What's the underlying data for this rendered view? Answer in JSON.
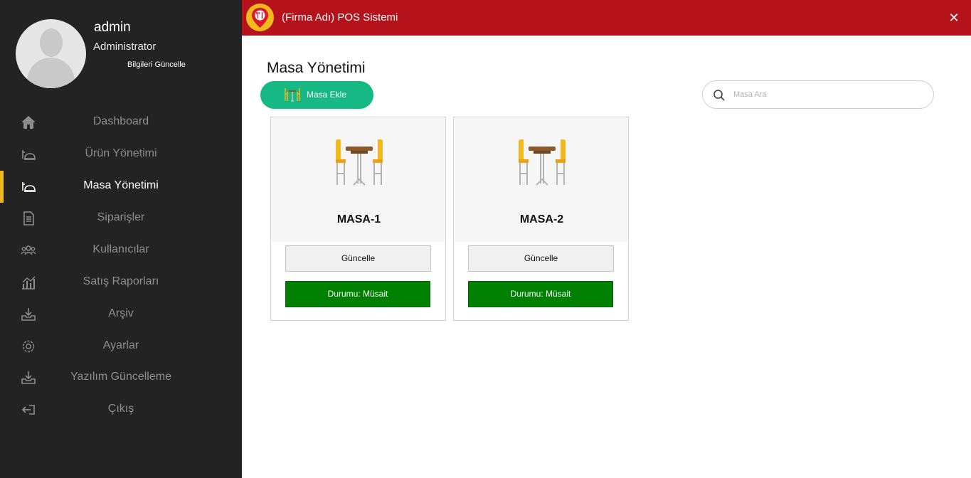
{
  "user": {
    "name": "admin",
    "role": "Administrator",
    "update_link": "Bilgileri Güncelle"
  },
  "sidebar": {
    "items": [
      {
        "label": "Dashboard",
        "icon": "home-icon"
      },
      {
        "label": "Ürün Yönetimi",
        "icon": "tray-icon"
      },
      {
        "label": "Masa Yönetimi",
        "icon": "tray-icon",
        "active": true
      },
      {
        "label": "Siparişler",
        "icon": "document-icon"
      },
      {
        "label": "Kullanıcılar",
        "icon": "users-icon"
      },
      {
        "label": "Satış Raporları",
        "icon": "chart-icon"
      },
      {
        "label": "Arşiv",
        "icon": "download-icon"
      },
      {
        "label": "Ayarlar",
        "icon": "gear-icon"
      },
      {
        "label": "Yazılım Güncelleme",
        "icon": "download-icon"
      },
      {
        "label": "Çıkış",
        "icon": "logout-icon"
      }
    ]
  },
  "titlebar": {
    "title": "(Firma Adı) POS Sistemi",
    "close": "✕"
  },
  "main": {
    "title": "Masa Yönetimi",
    "add_button": "Masa Ekle",
    "search_placeholder": "Masa Ara",
    "tables": [
      {
        "name": "MASA-1",
        "update_label": "Güncelle",
        "status_label": "Durumu: Müsait"
      },
      {
        "name": "MASA-2",
        "update_label": "Güncelle",
        "status_label": "Durumu: Müsait"
      }
    ]
  },
  "colors": {
    "sidebar_bg": "#232323",
    "titlebar_bg": "#b5121b",
    "accent_green": "#16b984",
    "status_green": "#008000",
    "active_marker": "#f2b91c"
  }
}
